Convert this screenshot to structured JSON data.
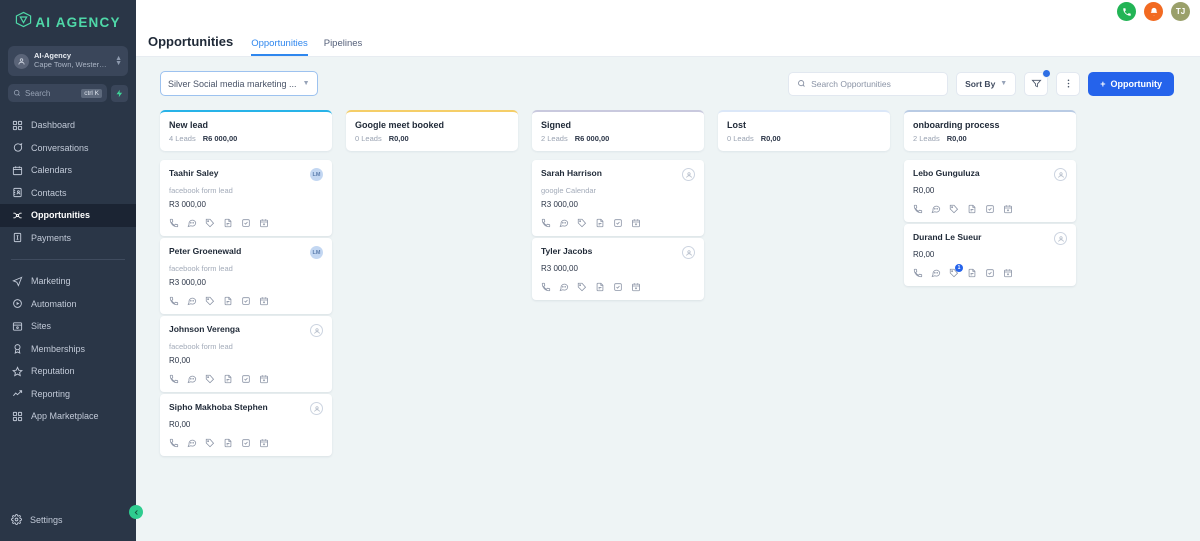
{
  "sidebar": {
    "logo_text": "AI AGENCY",
    "org": {
      "name": "AI-Agency",
      "location": "Cape Town, Western ..."
    },
    "search": {
      "placeholder": "Search",
      "shortcut": "ctrl K"
    },
    "nav_primary": [
      {
        "label": "Dashboard",
        "icon": "grid-icon",
        "active": false
      },
      {
        "label": "Conversations",
        "icon": "chat-icon",
        "active": false
      },
      {
        "label": "Calendars",
        "icon": "calendar-icon",
        "active": false
      },
      {
        "label": "Contacts",
        "icon": "contacts-icon",
        "active": false
      },
      {
        "label": "Opportunities",
        "icon": "opportunities-icon",
        "active": true
      },
      {
        "label": "Payments",
        "icon": "payments-icon",
        "active": false
      }
    ],
    "nav_secondary": [
      {
        "label": "Marketing",
        "icon": "send-icon"
      },
      {
        "label": "Automation",
        "icon": "automation-icon"
      },
      {
        "label": "Sites",
        "icon": "sites-icon"
      },
      {
        "label": "Memberships",
        "icon": "badge-icon"
      },
      {
        "label": "Reputation",
        "icon": "star-icon"
      },
      {
        "label": "Reporting",
        "icon": "trending-up-icon"
      },
      {
        "label": "App Marketplace",
        "icon": "grid-icon"
      }
    ],
    "settings_label": "Settings"
  },
  "topbar": {
    "phone_icon": "phone-icon",
    "bell_icon": "bell-icon",
    "avatar_initials": "TJ"
  },
  "page": {
    "title": "Opportunities",
    "tabs": [
      {
        "label": "Opportunities",
        "active": true
      },
      {
        "label": "Pipelines",
        "active": false
      }
    ]
  },
  "toolbar": {
    "pipeline_selected": "Silver Social media marketing ...",
    "search_placeholder": "Search Opportunities",
    "sort_by_label": "Sort By",
    "filter_icon": "filter-icon",
    "more_icon": "more-vertical-icon",
    "add_label": "Opportunity",
    "add_plus": "+",
    "accent_blue": "#2563eb"
  },
  "board": {
    "columns": [
      {
        "name": "New lead",
        "leads": "4 Leads",
        "amount": "R6 000,00",
        "accent": "#28b3e8",
        "cards": [
          {
            "name": "Taahir Saley",
            "source": "facebook form lead",
            "amount": "R3 000,00",
            "avatar_type": "initials",
            "avatar": "LM",
            "badge": null
          },
          {
            "name": "Peter Groenewald",
            "source": "facebook form lead",
            "amount": "R3 000,00",
            "avatar_type": "initials",
            "avatar": "LM",
            "badge": null
          },
          {
            "name": "Johnson Verenga",
            "source": "facebook form lead",
            "amount": "R0,00",
            "avatar_type": "anon",
            "avatar": "",
            "badge": null
          },
          {
            "name": "Sipho Makhoba Stephen",
            "source": "",
            "amount": "R0,00",
            "avatar_type": "anon",
            "avatar": "",
            "badge": null
          }
        ]
      },
      {
        "name": "Google meet booked",
        "leads": "0 Leads",
        "amount": "R0,00",
        "accent": "#f5ce68",
        "cards": []
      },
      {
        "name": "Signed",
        "leads": "2 Leads",
        "amount": "R6 000,00",
        "accent": "#c9c9de",
        "cards": [
          {
            "name": "Sarah Harrison",
            "source": "google Calendar",
            "amount": "R3 000,00",
            "avatar_type": "anon",
            "avatar": "",
            "badge": null
          },
          {
            "name": "Tyler Jacobs",
            "source": "",
            "amount": "R3 000,00",
            "avatar_type": "anon",
            "avatar": "",
            "badge": null
          }
        ]
      },
      {
        "name": "Lost",
        "leads": "0 Leads",
        "amount": "R0,00",
        "accent": "#dbe7f8",
        "cards": []
      },
      {
        "name": "onboarding process",
        "leads": "2 Leads",
        "amount": "R0,00",
        "accent": "#b9cbe4",
        "cards": [
          {
            "name": "Lebo Gunguluza",
            "source": "",
            "amount": "R0,00",
            "avatar_type": "anon",
            "avatar": "",
            "badge": null
          },
          {
            "name": "Durand Le Sueur",
            "source": "",
            "amount": "R0,00",
            "avatar_type": "anon",
            "avatar": "",
            "badge": "1"
          }
        ]
      }
    ],
    "card_action_icons": [
      "phone-icon",
      "chat-icon",
      "tag-icon",
      "document-icon",
      "task-icon",
      "calendar-add-icon"
    ]
  }
}
